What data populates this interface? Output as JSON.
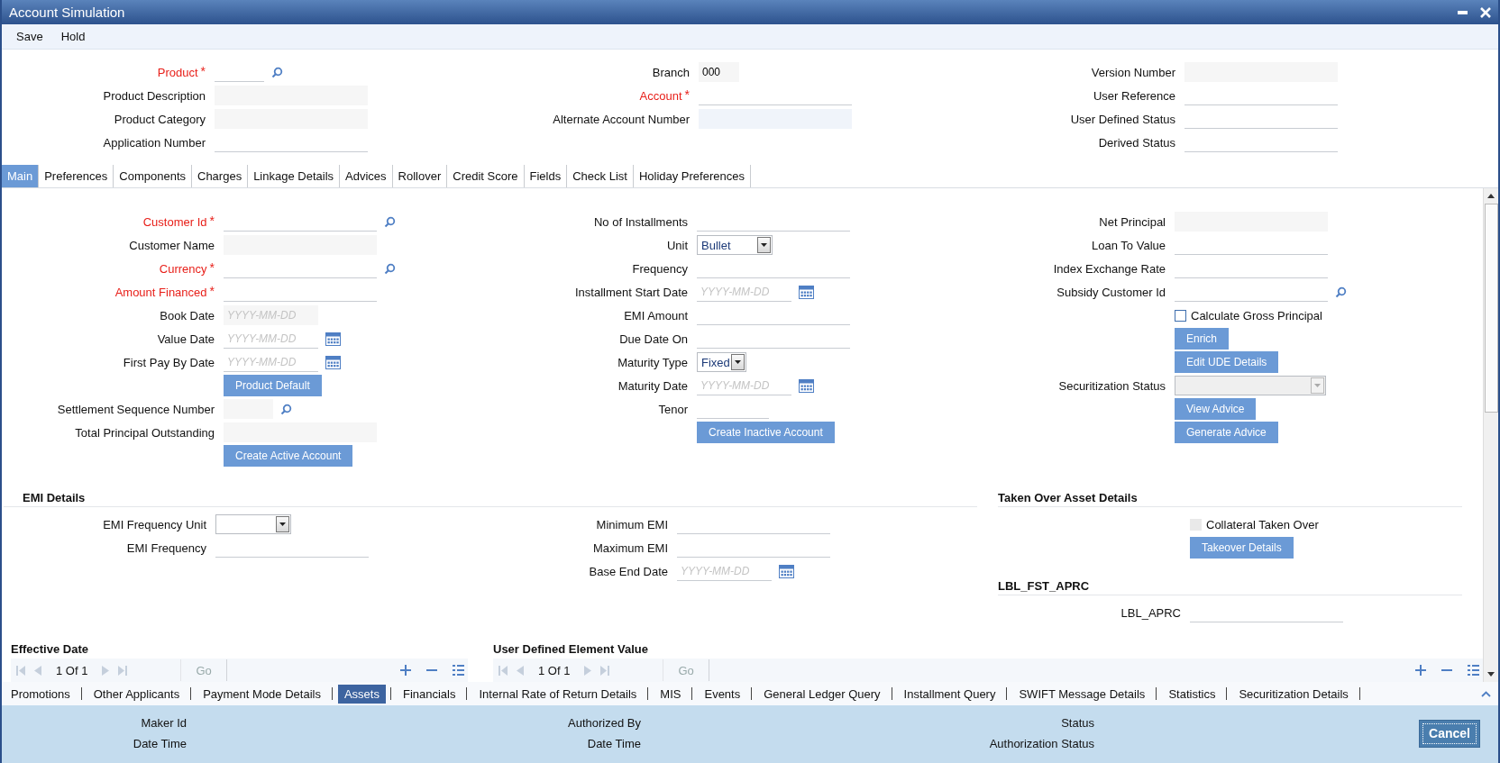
{
  "window": {
    "title": "Account Simulation"
  },
  "toolbar": [
    {
      "label": "Save"
    },
    {
      "label": "Hold"
    }
  ],
  "header": {
    "columns": [
      [
        {
          "label": "Product",
          "required_mark": "*",
          "kind": "short_lookup"
        },
        {
          "label": "Product Description",
          "kind": "readonly"
        },
        {
          "label": "Product Category",
          "kind": "readonly"
        },
        {
          "label": "Application Number",
          "kind": "text"
        }
      ],
      [
        {
          "label": "Branch",
          "kind": "readonly_short",
          "value": "000"
        },
        {
          "label": "Account",
          "required_mark": "*",
          "kind": "text"
        },
        {
          "label": "Alternate Account Number",
          "kind": "readonly_blue"
        }
      ],
      [
        {
          "label": "Version Number",
          "kind": "readonly"
        },
        {
          "label": "User Reference",
          "kind": "text"
        },
        {
          "label": "User Defined Status",
          "kind": "text"
        },
        {
          "label": "Derived Status",
          "kind": "text"
        }
      ]
    ]
  },
  "tabs": [
    {
      "label": "Main",
      "selected": true
    },
    {
      "label": "Preferences",
      "selected": false
    },
    {
      "label": "Components",
      "selected": false
    },
    {
      "label": "Charges",
      "selected": false
    },
    {
      "label": "Linkage Details",
      "selected": false
    },
    {
      "label": "Advices",
      "selected": false
    },
    {
      "label": "Rollover",
      "selected": false
    },
    {
      "label": "Credit Score",
      "selected": false
    },
    {
      "label": "Fields",
      "selected": false
    },
    {
      "label": "Check List",
      "selected": false
    },
    {
      "label": "Holiday Preferences",
      "selected": false
    }
  ],
  "main": {
    "columns": [
      [
        {
          "label": "Customer Id",
          "required_mark": "*",
          "kind": "lookup"
        },
        {
          "label": "Customer Name",
          "kind": "readonly"
        },
        {
          "label": "Currency",
          "required_mark": "*",
          "kind": "lookup"
        },
        {
          "label": "Amount Financed",
          "required_mark": "*",
          "kind": "text"
        },
        {
          "label": "Book Date",
          "kind": "date",
          "placeholder": "YYYY-MM-DD"
        },
        {
          "label": "Value Date",
          "kind": "date_picker",
          "placeholder": "YYYY-MM-DD"
        },
        {
          "label": "First Pay By Date",
          "kind": "date_picker",
          "placeholder": "YYYY-MM-DD"
        },
        {
          "label": "Product Default",
          "kind": "button"
        },
        {
          "label": "Settlement Sequence Number",
          "kind": "readonly_short_lookup"
        },
        {
          "label": "Total Principal Outstanding",
          "kind": "readonly"
        },
        {
          "label": "Create Active Account",
          "kind": "button"
        }
      ],
      [
        {
          "label": "No of Installments",
          "kind": "text"
        },
        {
          "label": "Unit",
          "kind": "select",
          "value": "Bullet"
        },
        {
          "label": "Frequency",
          "kind": "text"
        },
        {
          "label": "Installment Start Date",
          "kind": "date_picker",
          "placeholder": "YYYY-MM-DD"
        },
        {
          "label": "EMI Amount",
          "kind": "text"
        },
        {
          "label": "Due Date On",
          "kind": "text"
        },
        {
          "label": "Maturity Type",
          "kind": "narrow_select",
          "value": "Fixed"
        },
        {
          "label": "Maturity Date",
          "kind": "date_picker",
          "placeholder": "YYYY-MM-DD"
        },
        {
          "label": "Tenor",
          "kind": "short_text"
        },
        {
          "label": "Create Inactive Account",
          "kind": "button"
        }
      ],
      [
        {
          "label": "Net Principal",
          "kind": "readonly"
        },
        {
          "label": "Loan To Value",
          "kind": "text"
        },
        {
          "label": "Index Exchange Rate",
          "kind": "text"
        },
        {
          "label": "Subsidy Customer Id",
          "kind": "lookup"
        },
        {
          "label": "Calculate Gross Principal",
          "kind": "checkbox",
          "checked": false,
          "disabled": false
        },
        {
          "label": "Enrich",
          "kind": "button"
        },
        {
          "label": "Edit UDE Details",
          "kind": "button"
        },
        {
          "label": "Securitization Status",
          "kind": "disabled_select"
        },
        {
          "label": "View Advice",
          "kind": "button"
        },
        {
          "label": "Generate Advice",
          "kind": "button"
        }
      ]
    ]
  },
  "emi_details": {
    "title": "EMI Details",
    "columns": [
      [
        {
          "label": "EMI Frequency Unit",
          "kind": "select"
        },
        {
          "label": "EMI Frequency",
          "kind": "text"
        }
      ],
      [
        {
          "label": "Minimum EMI",
          "kind": "text"
        },
        {
          "label": "Maximum EMI",
          "kind": "text"
        },
        {
          "label": "Base End Date",
          "kind": "date_picker",
          "placeholder": "YYYY-MM-DD"
        }
      ]
    ]
  },
  "taken_over_asset_details": {
    "title": "Taken Over Asset Details",
    "fields": [
      {
        "label": "Collateral Taken Over",
        "kind": "checkbox",
        "checked": false,
        "disabled": true
      },
      {
        "label": "Takeover Details",
        "kind": "button"
      }
    ]
  },
  "aprc": {
    "title": "LBL_FST_APRC",
    "fields": [
      {
        "label": "LBL_APRC",
        "kind": "text"
      }
    ]
  },
  "grids": [
    {
      "title": "Effective Date",
      "page_info": "1 Of 1",
      "go": "Go"
    },
    {
      "title": "User Defined Element Value",
      "page_info": "1 Of 1",
      "go": "Go"
    }
  ],
  "bottom_tabs": [
    {
      "label": "Promotions",
      "selected": false
    },
    {
      "label": "Other Applicants",
      "selected": false
    },
    {
      "label": "Payment Mode Details",
      "selected": false
    },
    {
      "label": "Assets",
      "selected": true
    },
    {
      "label": "Financials",
      "selected": false
    },
    {
      "label": "Internal Rate of Return Details",
      "selected": false
    },
    {
      "label": "MIS",
      "selected": false
    },
    {
      "label": "Events",
      "selected": false
    },
    {
      "label": "General Ledger Query",
      "selected": false
    },
    {
      "label": "Installment Query",
      "selected": false
    },
    {
      "label": "SWIFT Message Details",
      "selected": false
    },
    {
      "label": "Statistics",
      "selected": false
    },
    {
      "label": "Securitization Details",
      "selected": false
    }
  ],
  "footer": {
    "columns": [
      [
        {
          "label": "Maker Id"
        },
        {
          "label": "Date Time"
        }
      ],
      [
        {
          "label": "Authorized By"
        },
        {
          "label": "Date Time"
        }
      ],
      [
        {
          "label": "Status"
        },
        {
          "label": "Authorization Status"
        }
      ]
    ],
    "cancel": "Cancel"
  }
}
